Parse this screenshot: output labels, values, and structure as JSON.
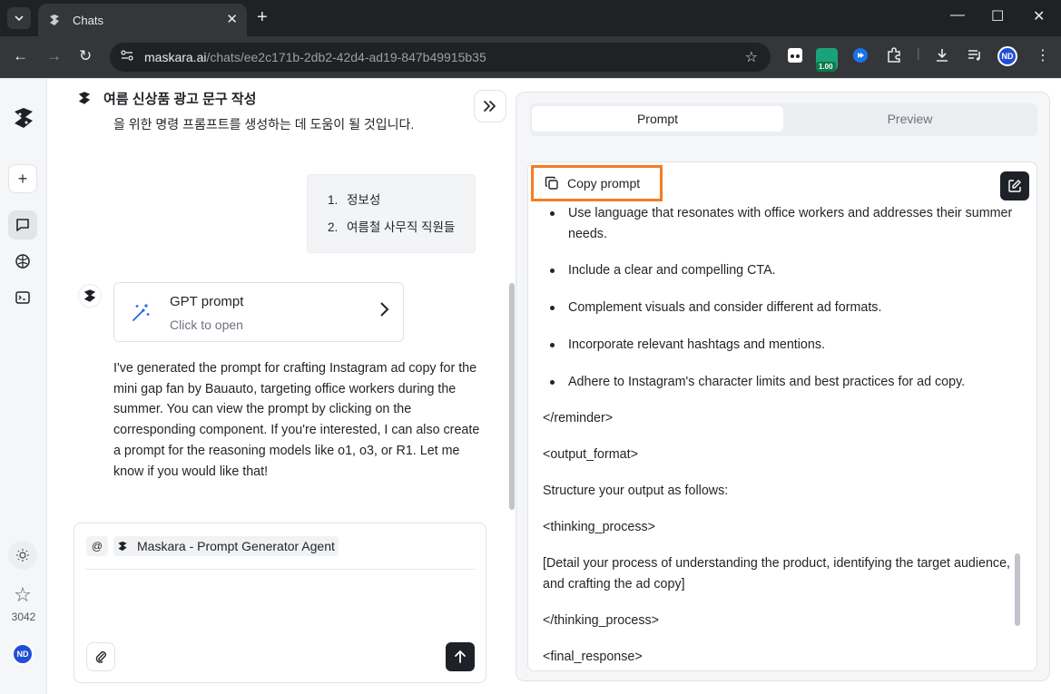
{
  "browser": {
    "tab_title": "Chats",
    "url_host": "maskara.ai",
    "url_path": "/chats/ee2c171b-2db2-42d4-ad19-847b49915b35",
    "extension_badge": "1.00",
    "profile_initials": "ND",
    "icons": [
      "tab-search-icon",
      "close-icon",
      "plus-icon",
      "minimize-icon",
      "maximize-icon",
      "close-window-icon",
      "back-icon",
      "forward-icon",
      "reload-icon",
      "site-info-icon",
      "bookmark-star-icon",
      "extensions-icon",
      "download-icon",
      "media-icon",
      "menu-icon"
    ]
  },
  "sidebar": {
    "star_count": "3042",
    "avatar_initials": "ND"
  },
  "chat": {
    "title": "여름 신상품 광고 문구 작성",
    "subtitle": "을 위한 명령 프롬프트를 생성하는 데 도움이 될 것입니다.",
    "user_list": [
      {
        "num": "1.",
        "text": "정보성"
      },
      {
        "num": "2.",
        "text": "여름철 사무직 직원들"
      }
    ],
    "card": {
      "title": "GPT prompt",
      "subtitle": "Click to open"
    },
    "bot_message": "I've generated the prompt for crafting Instagram ad copy for the mini gap fan by Bauauto, targeting office workers during the summer. You can view the prompt by clicking on the corresponding component. If you're interested, I can also create a prompt for the reasoning models like o1, o3, or R1. Let me know if you would like that!",
    "composer": {
      "mention_symbol": "@",
      "agent_name": "Maskara - Prompt Generator Agent"
    }
  },
  "panel": {
    "tabs": [
      {
        "label": "Prompt",
        "active": true
      },
      {
        "label": "Preview",
        "active": false
      }
    ],
    "copy_label": "Copy prompt",
    "bullets": [
      "Use language that resonates with office workers and addresses their summer needs.",
      "Include a clear and compelling CTA.",
      "Complement visuals and consider different ad formats.",
      "Incorporate relevant hashtags and mentions.",
      "Adhere to Instagram's character limits and best practices for ad copy."
    ],
    "paragraphs": [
      "</reminder>",
      "<output_format>",
      "Structure your output as follows:",
      "<thinking_process>",
      "[Detail your process of understanding the product, identifying the target audience, and crafting the ad copy]",
      "</thinking_process>",
      "<final_response>"
    ]
  },
  "colors": {
    "highlight": "#f57c22",
    "dark_button": "#1e2128",
    "chrome_dark": "#202124"
  }
}
